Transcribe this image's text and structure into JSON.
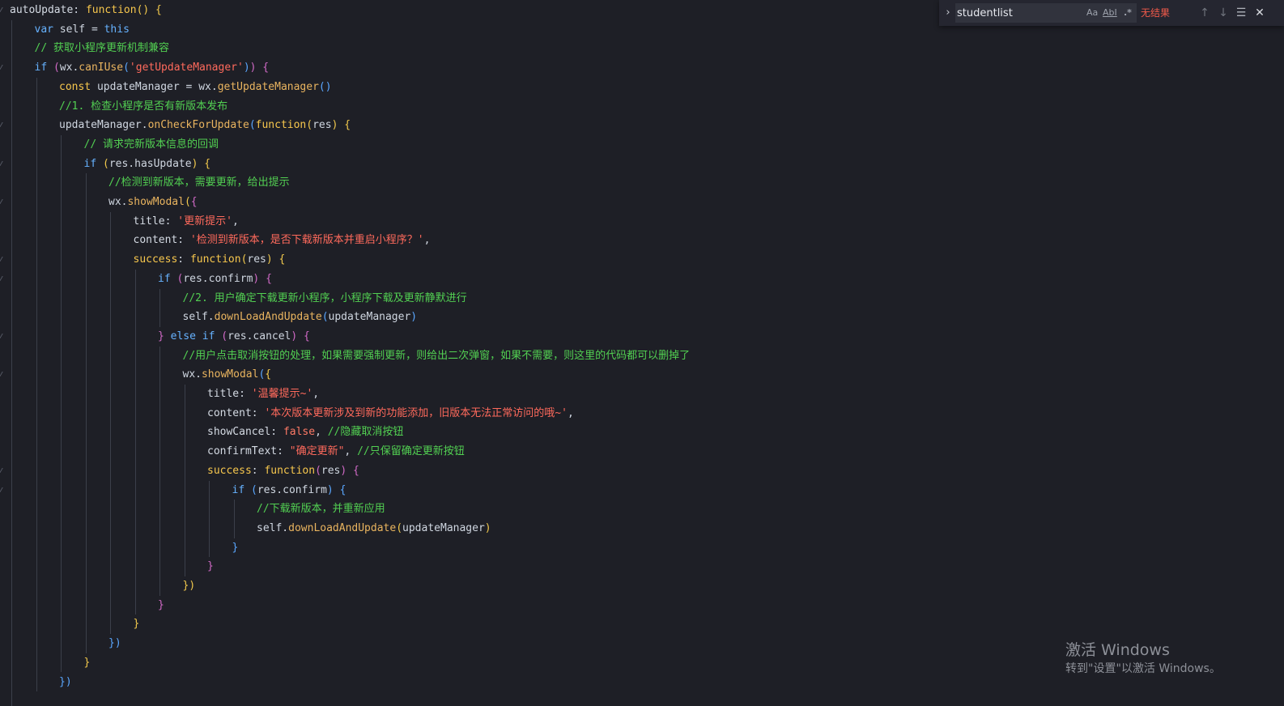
{
  "editor": {
    "lines": [
      {
        "indent": 0,
        "tokens": [
          [
            "prop",
            "autoUpdate"
          ],
          [
            "pun",
            ": "
          ],
          [
            "kw",
            "function"
          ],
          [
            "br1",
            "() {"
          ]
        ]
      },
      {
        "indent": 1,
        "tokens": [
          [
            "kw2",
            "var"
          ],
          [
            "plain",
            " self = "
          ],
          [
            "kw2",
            "this"
          ]
        ]
      },
      {
        "indent": 1,
        "tokens": [
          [
            "cmt",
            "// 获取小程序更新机制兼容"
          ]
        ]
      },
      {
        "indent": 1,
        "tokens": [
          [
            "kw2",
            "if"
          ],
          [
            "plain",
            " "
          ],
          [
            "br2",
            "("
          ],
          [
            "plain",
            "wx."
          ],
          [
            "fn",
            "canIUse"
          ],
          [
            "br3",
            "("
          ],
          [
            "str",
            "'getUpdateManager'"
          ],
          [
            "br3",
            ")"
          ],
          [
            "br2",
            ")"
          ],
          [
            "plain",
            " "
          ],
          [
            "br2",
            "{"
          ]
        ]
      },
      {
        "indent": 2,
        "tokens": [
          [
            "kw",
            "const"
          ],
          [
            "plain",
            " updateManager = wx."
          ],
          [
            "fn",
            "getUpdateManager"
          ],
          [
            "br3",
            "()"
          ]
        ]
      },
      {
        "indent": 2,
        "tokens": [
          [
            "cmt",
            "//1. 检查小程序是否有新版本发布"
          ]
        ]
      },
      {
        "indent": 2,
        "tokens": [
          [
            "plain",
            "updateManager."
          ],
          [
            "fn",
            "onCheckForUpdate"
          ],
          [
            "br3",
            "("
          ],
          [
            "kw",
            "function"
          ],
          [
            "br1",
            "("
          ],
          [
            "param",
            "res"
          ],
          [
            "br1",
            ")"
          ],
          [
            "plain",
            " "
          ],
          [
            "br1",
            "{"
          ]
        ]
      },
      {
        "indent": 3,
        "tokens": [
          [
            "cmt",
            "// 请求完新版本信息的回调"
          ]
        ]
      },
      {
        "indent": 3,
        "tokens": [
          [
            "kw2",
            "if"
          ],
          [
            "plain",
            " "
          ],
          [
            "br1",
            "("
          ],
          [
            "plain",
            "res.hasUpdate"
          ],
          [
            "br1",
            ")"
          ],
          [
            "plain",
            " "
          ],
          [
            "br1",
            "{"
          ]
        ]
      },
      {
        "indent": 4,
        "tokens": [
          [
            "cmt",
            "//检测到新版本，需要更新，给出提示"
          ]
        ]
      },
      {
        "indent": 4,
        "tokens": [
          [
            "plain",
            "wx."
          ],
          [
            "fn",
            "showModal"
          ],
          [
            "br1",
            "("
          ],
          [
            "br2",
            "{"
          ]
        ]
      },
      {
        "indent": 5,
        "tokens": [
          [
            "prop",
            "title"
          ],
          [
            "pun",
            ": "
          ],
          [
            "str",
            "'更新提示'"
          ],
          [
            "pun",
            ","
          ]
        ]
      },
      {
        "indent": 5,
        "tokens": [
          [
            "prop",
            "content"
          ],
          [
            "pun",
            ": "
          ],
          [
            "str",
            "'检测到新版本，是否下载新版本并重启小程序？'"
          ],
          [
            "pun",
            ","
          ]
        ]
      },
      {
        "indent": 5,
        "tokens": [
          [
            "kw",
            "success"
          ],
          [
            "pun",
            ": "
          ],
          [
            "kw",
            "function"
          ],
          [
            "br1",
            "("
          ],
          [
            "param",
            "res"
          ],
          [
            "br1",
            ")"
          ],
          [
            "plain",
            " "
          ],
          [
            "br1",
            "{"
          ]
        ]
      },
      {
        "indent": 6,
        "tokens": [
          [
            "kw2",
            "if"
          ],
          [
            "plain",
            " "
          ],
          [
            "br2",
            "("
          ],
          [
            "plain",
            "res.confirm"
          ],
          [
            "br2",
            ")"
          ],
          [
            "plain",
            " "
          ],
          [
            "br2",
            "{"
          ]
        ]
      },
      {
        "indent": 7,
        "tokens": [
          [
            "cmt",
            "//2. 用户确定下载更新小程序，小程序下载及更新静默进行"
          ]
        ]
      },
      {
        "indent": 7,
        "tokens": [
          [
            "plain",
            "self."
          ],
          [
            "fn",
            "downLoadAndUpdate"
          ],
          [
            "br3",
            "("
          ],
          [
            "plain",
            "updateManager"
          ],
          [
            "br3",
            ")"
          ]
        ]
      },
      {
        "indent": 6,
        "tokens": [
          [
            "br2",
            "}"
          ],
          [
            "plain",
            " "
          ],
          [
            "kw2",
            "else if"
          ],
          [
            "plain",
            " "
          ],
          [
            "br2",
            "("
          ],
          [
            "plain",
            "res.cancel"
          ],
          [
            "br2",
            ")"
          ],
          [
            "plain",
            " "
          ],
          [
            "br2",
            "{"
          ]
        ]
      },
      {
        "indent": 7,
        "tokens": [
          [
            "cmt",
            "//用户点击取消按钮的处理，如果需要强制更新，则给出二次弹窗，如果不需要，则这里的代码都可以删掉了"
          ]
        ]
      },
      {
        "indent": 7,
        "tokens": [
          [
            "plain",
            "wx."
          ],
          [
            "fn",
            "showModal"
          ],
          [
            "br3",
            "("
          ],
          [
            "br1",
            "{"
          ]
        ]
      },
      {
        "indent": 8,
        "tokens": [
          [
            "prop",
            "title"
          ],
          [
            "pun",
            ": "
          ],
          [
            "str",
            "'温馨提示~'"
          ],
          [
            "pun",
            ","
          ]
        ]
      },
      {
        "indent": 8,
        "tokens": [
          [
            "prop",
            "content"
          ],
          [
            "pun",
            ": "
          ],
          [
            "str",
            "'本次版本更新涉及到新的功能添加，旧版本无法正常访问的哦~'"
          ],
          [
            "pun",
            ","
          ]
        ]
      },
      {
        "indent": 8,
        "tokens": [
          [
            "prop",
            "showCancel"
          ],
          [
            "pun",
            ": "
          ],
          [
            "bool",
            "false"
          ],
          [
            "pun",
            ", "
          ],
          [
            "cmt",
            "//隐藏取消按钮"
          ]
        ]
      },
      {
        "indent": 8,
        "tokens": [
          [
            "prop",
            "confirmText"
          ],
          [
            "pun",
            ": "
          ],
          [
            "str",
            "\"确定更新\""
          ],
          [
            "pun",
            ", "
          ],
          [
            "cmt",
            "//只保留确定更新按钮"
          ]
        ]
      },
      {
        "indent": 8,
        "tokens": [
          [
            "kw",
            "success"
          ],
          [
            "pun",
            ": "
          ],
          [
            "kw",
            "function"
          ],
          [
            "br2",
            "("
          ],
          [
            "param",
            "res"
          ],
          [
            "br2",
            ")"
          ],
          [
            "plain",
            " "
          ],
          [
            "br2",
            "{"
          ]
        ]
      },
      {
        "indent": 9,
        "tokens": [
          [
            "kw2",
            "if"
          ],
          [
            "plain",
            " "
          ],
          [
            "br3",
            "("
          ],
          [
            "plain",
            "res.confirm"
          ],
          [
            "br3",
            ")"
          ],
          [
            "plain",
            " "
          ],
          [
            "br3",
            "{"
          ]
        ]
      },
      {
        "indent": 10,
        "tokens": [
          [
            "cmt",
            "//下载新版本，并重新应用"
          ]
        ]
      },
      {
        "indent": 10,
        "tokens": [
          [
            "plain",
            "self."
          ],
          [
            "fn",
            "downLoadAndUpdate"
          ],
          [
            "br1",
            "("
          ],
          [
            "plain",
            "updateManager"
          ],
          [
            "br1",
            ")"
          ]
        ]
      },
      {
        "indent": 9,
        "tokens": [
          [
            "br3",
            "}"
          ]
        ]
      },
      {
        "indent": 8,
        "tokens": [
          [
            "br2",
            "}"
          ]
        ]
      },
      {
        "indent": 7,
        "tokens": [
          [
            "br1",
            "})"
          ]
        ]
      },
      {
        "indent": 6,
        "tokens": [
          [
            "br2",
            "}"
          ]
        ]
      },
      {
        "indent": 5,
        "tokens": [
          [
            "br1",
            "}"
          ]
        ]
      },
      {
        "indent": 4,
        "tokens": [
          [
            "br3",
            "})"
          ]
        ]
      },
      {
        "indent": 3,
        "tokens": [
          [
            "br1",
            "}"
          ]
        ]
      },
      {
        "indent": 2,
        "tokens": [
          [
            "br3",
            "})"
          ]
        ]
      }
    ]
  },
  "find_widget": {
    "query": "studentlist",
    "match_case_label": "Aa",
    "whole_word_label": "AbI",
    "regex_label": ".*",
    "result_text": "无结果",
    "toggle_icon": "chevron-right-icon",
    "prev_icon": "arrow-up-icon",
    "next_icon": "arrow-down-icon",
    "selection_icon": "find-in-selection-icon",
    "close_icon": "close-icon"
  },
  "watermark": {
    "title": "激活 Windows",
    "subtitle": "转到\"设置\"以激活 Windows。"
  },
  "colors": {
    "background": "#1e1f26",
    "keyword": "#f7c74d",
    "keyword_blue": "#66b2ff",
    "string": "#ff6a5c",
    "comment": "#52d052",
    "function": "#e9b45f",
    "no_results": "#f25a4a"
  }
}
